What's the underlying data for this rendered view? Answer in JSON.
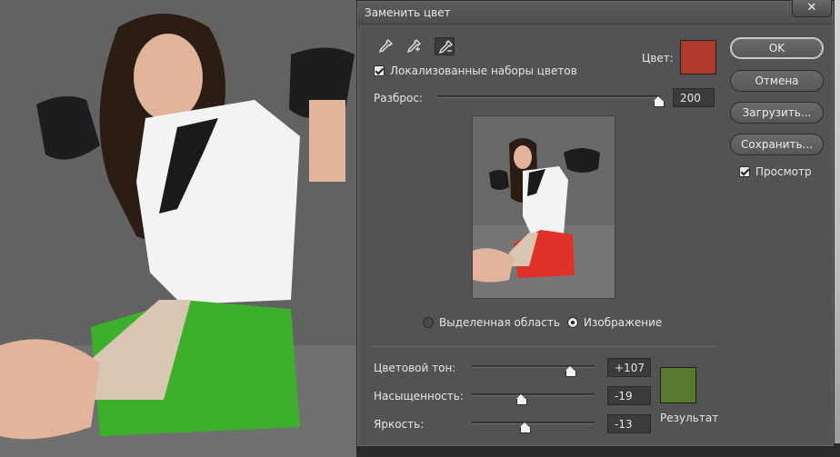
{
  "dialog": {
    "title": "Заменить цвет",
    "close_glyph": "✕",
    "tools": [
      "eyedropper-icon",
      "eyedropper-plus-icon",
      "eyedropper-minus-icon"
    ],
    "localized_label": "Локализованные наборы цветов",
    "color_label": "Цвет:",
    "fuzziness_label": "Разброс:",
    "fuzziness_value": "200",
    "selection_radio": "Выделенная область",
    "image_radio": "Изображение",
    "hue_label": "Цветовой тон:",
    "hue_value": "+107",
    "saturation_label": "Насыщенность:",
    "saturation_value": "-19",
    "lightness_label": "Яркость:",
    "lightness_value": "-13",
    "result_label": "Результат"
  },
  "buttons": {
    "ok": "OK",
    "cancel": "Отмена",
    "load": "Загрузить...",
    "save": "Сохранить...",
    "preview": "Просмотр"
  },
  "state": {
    "localized_checked": true,
    "preview_checked": true,
    "selected_radio": "image",
    "fuzziness_fraction": 1.0,
    "hue_fraction": 0.8,
    "saturation_fraction": 0.4,
    "lightness_fraction": 0.43
  },
  "colors": {
    "target_color": "#b13a2f",
    "result_color": "#557a2d",
    "skirt_green": "#3cb02a"
  }
}
